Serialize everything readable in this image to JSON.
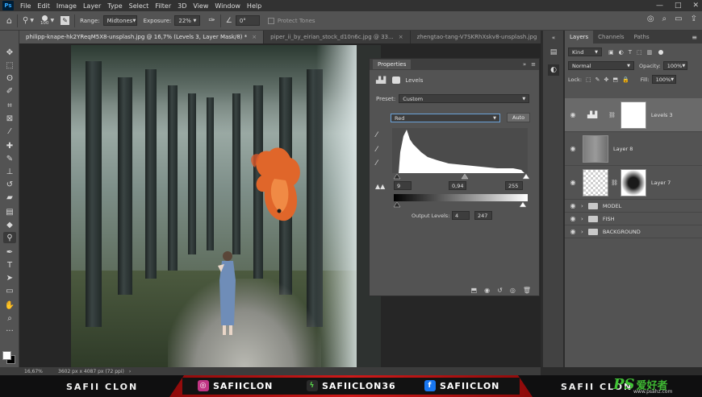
{
  "menubar": {
    "logo": "Ps",
    "items": [
      "File",
      "Edit",
      "Image",
      "Layer",
      "Type",
      "Select",
      "Filter",
      "3D",
      "View",
      "Window",
      "Help"
    ],
    "window_controls": [
      "—",
      "□",
      "✕"
    ]
  },
  "options_bar": {
    "brush_size": "100",
    "range_label": "Range:",
    "range_value": "Midtones",
    "exposure_label": "Exposure:",
    "exposure_value": "22%",
    "angle_value": "0°",
    "protect_tones": "Protect Tones"
  },
  "tabs": [
    {
      "label": "philipp-knape-hk2YReqM5X8-unsplash.jpg @ 16,7% (Levels 3, Layer Mask/8) *",
      "active": true
    },
    {
      "label": "piper_ii_by_eirian_stock_d10n6c.jpg @ 33...",
      "active": false
    },
    {
      "label": "zhengtao-tang-V7SKRhXskv8-unsplash.jpg",
      "active": false
    }
  ],
  "status_bar": {
    "zoom": "16,67%",
    "doc_info": "3602 px x 4087 px (72 ppi)"
  },
  "properties": {
    "tab": "Properties",
    "adjustment": "Levels",
    "preset_label": "Preset:",
    "preset_value": "Custom",
    "channel_value": "Red",
    "auto_label": "Auto",
    "input_black": "9",
    "input_gamma": "0,94",
    "input_white": "255",
    "output_label": "Output Levels:",
    "output_black": "4",
    "output_white": "247"
  },
  "layers_panel": {
    "tabs": [
      "Layers",
      "Channels",
      "Paths"
    ],
    "kind_value": "Kind",
    "blend_mode": "Normal",
    "opacity_label": "Opacity:",
    "opacity_value": "100%",
    "lock_label": "Lock:",
    "fill_label": "Fill:",
    "fill_value": "100%",
    "layers": [
      {
        "name": "Levels 3",
        "selected": true
      },
      {
        "name": "Layer 8",
        "selected": false
      },
      {
        "name": "Layer 7",
        "selected": false
      }
    ],
    "groups": [
      "MODEL",
      "FISH",
      "BACKGROUND"
    ]
  },
  "banner": {
    "name_left": "SAFII CLON",
    "instagram": "SAFIICLON",
    "other": "SAFIICLON36",
    "facebook": "SAFIICLON",
    "name_right": "SAFII CLON",
    "watermark_ps": "PS",
    "watermark_cn": "爱好者",
    "watermark_url": "www.psahz.com"
  },
  "colors": {
    "accent_red": "#d01919",
    "watermark_green": "#42c236",
    "instagram": "#c13584",
    "facebook": "#1877f2"
  }
}
